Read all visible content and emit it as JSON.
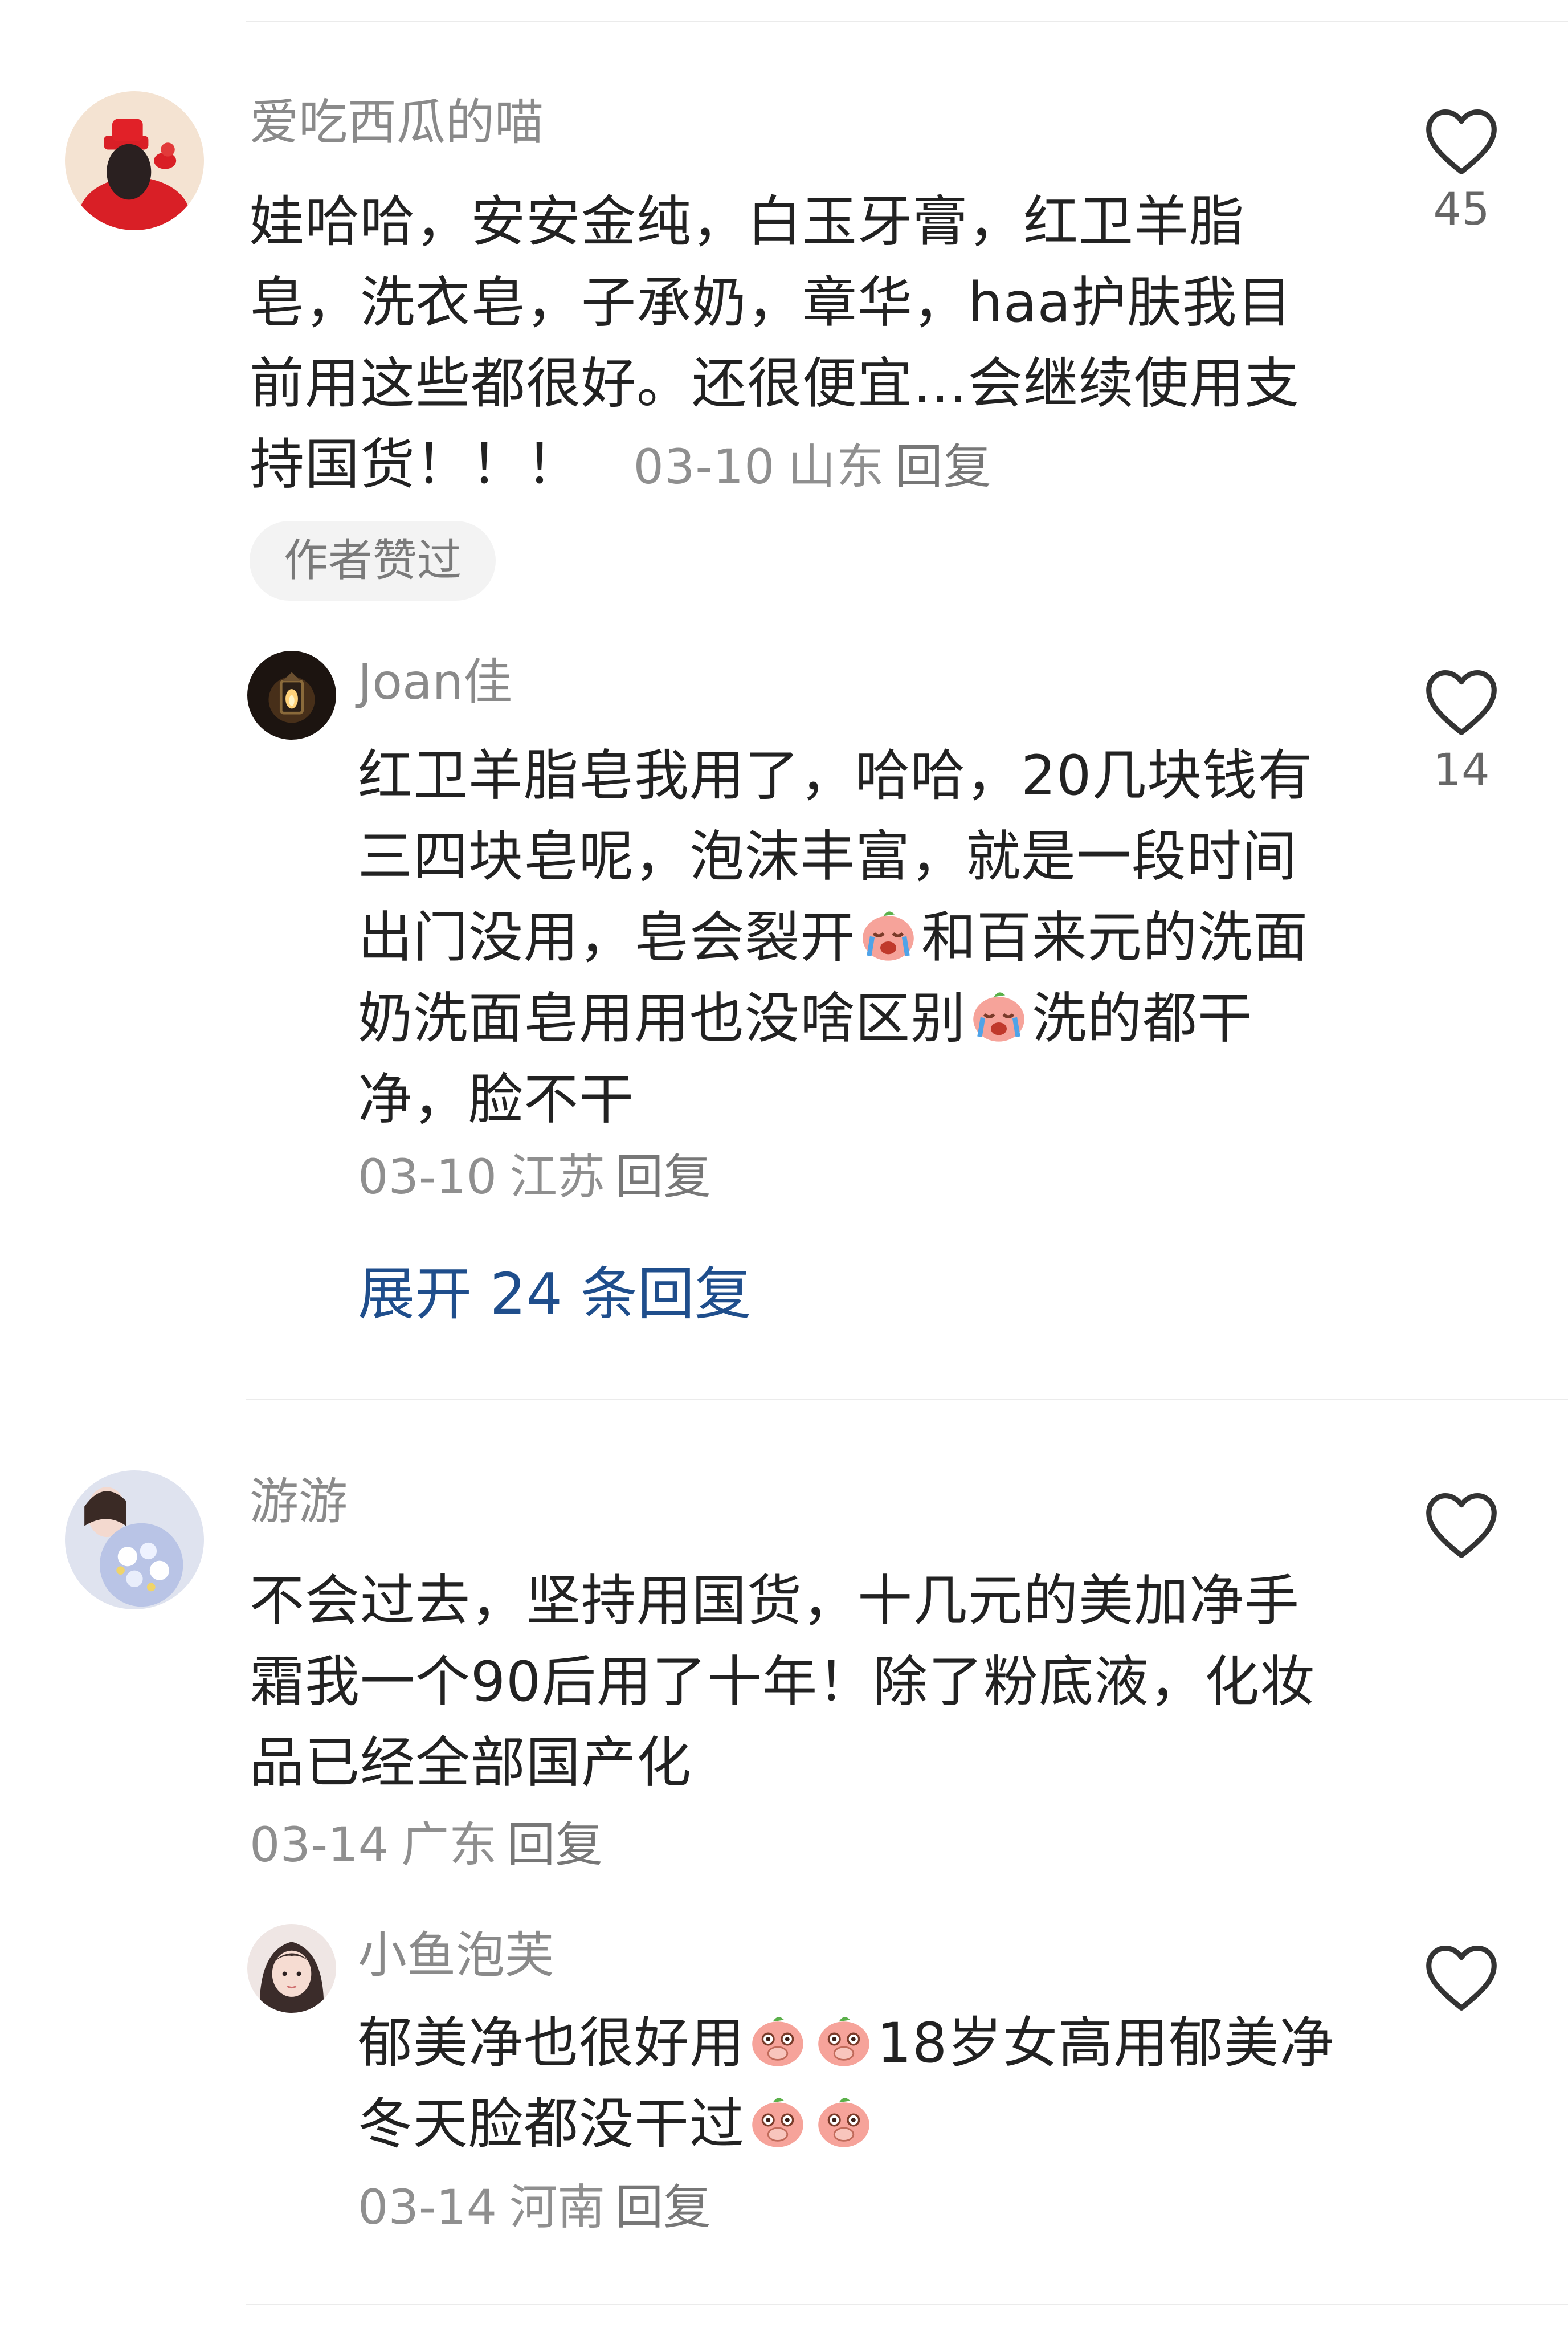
{
  "comments": [
    {
      "username": "爱吃西瓜的喵",
      "text": "娃哈哈，安安金纯，白玉牙膏，红卫羊脂皂，洗衣皂，子承奶，章华，haa护肤我目前用这些都很好。还很便宜…会继续使用支持国货！！！",
      "date": "03-10",
      "region": "山东",
      "reply_label": "回复",
      "badge": "作者赞过",
      "likes": "45",
      "avatar": "red-hat-avatar",
      "replies": [
        {
          "username": "Joan佳",
          "text_before_emoji_1": "红卫羊脂皂我用了，哈哈，20几块钱有三四块皂呢，泡沫丰富，就是一段时间出门没用，皂会裂开",
          "text_between": "和百来元的洗面奶洗面皂用用也没啥区别",
          "text_after": "洗的都干净，脸不干",
          "emoji": "crying-peach-emoji",
          "date": "03-10",
          "region": "江苏",
          "reply_label": "回复",
          "likes": "14",
          "avatar": "lantern-avatar"
        }
      ],
      "expand_label": "展开 24 条回复"
    },
    {
      "username": "游游",
      "text": "不会过去，坚持用国货，十几元的美加净手霜我一个90后用了十年！除了粉底液，化妆品已经全部国产化",
      "date": "03-14",
      "region": "广东",
      "reply_label": "回复",
      "avatar": "flowers-avatar",
      "replies": [
        {
          "username": "小鱼泡芙",
          "text_part_1": "郁美净也很好用",
          "text_part_2": "18岁女高用郁美净冬天脸都没干过",
          "emoji": "shy-peach-emoji",
          "date": "03-14",
          "region": "河南",
          "reply_label": "回复",
          "avatar": "girl-portrait-avatar"
        }
      ]
    }
  ],
  "colors": {
    "expand_link": "#1f4e8c",
    "meta_text": "#8f8f8f",
    "username": "#8a8a8a",
    "badge_bg": "#f3f3f3"
  }
}
